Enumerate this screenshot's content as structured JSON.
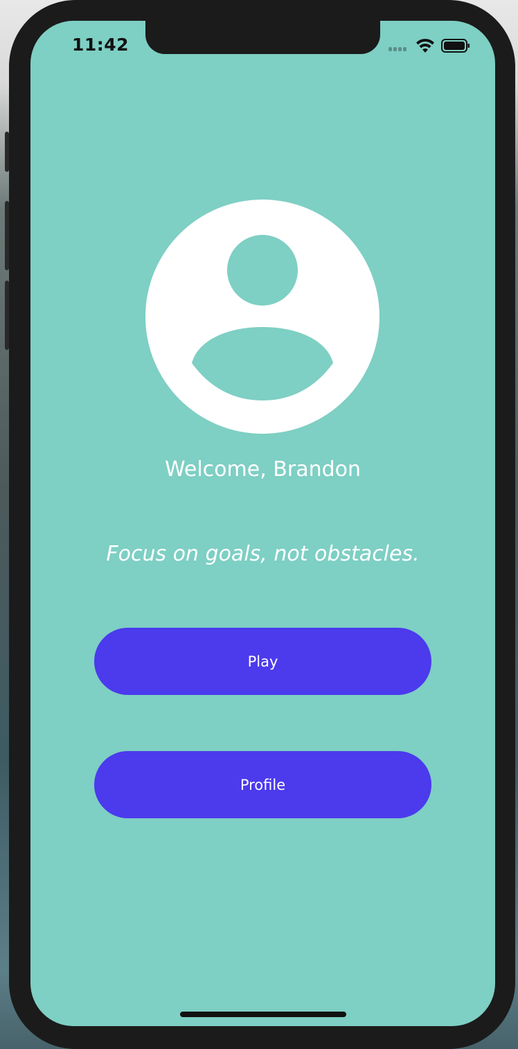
{
  "status_bar": {
    "time": "11:42"
  },
  "profile": {
    "avatar_icon": "user-avatar-icon",
    "welcome_text": "Welcome, Brandon"
  },
  "quote": {
    "text": "Focus on goals, not obstacles."
  },
  "actions": {
    "play_label": "Play",
    "profile_label": "Profile"
  },
  "colors": {
    "screen_background": "#7ecfc4",
    "button_background": "#4c3aed",
    "text": "#ffffff"
  }
}
